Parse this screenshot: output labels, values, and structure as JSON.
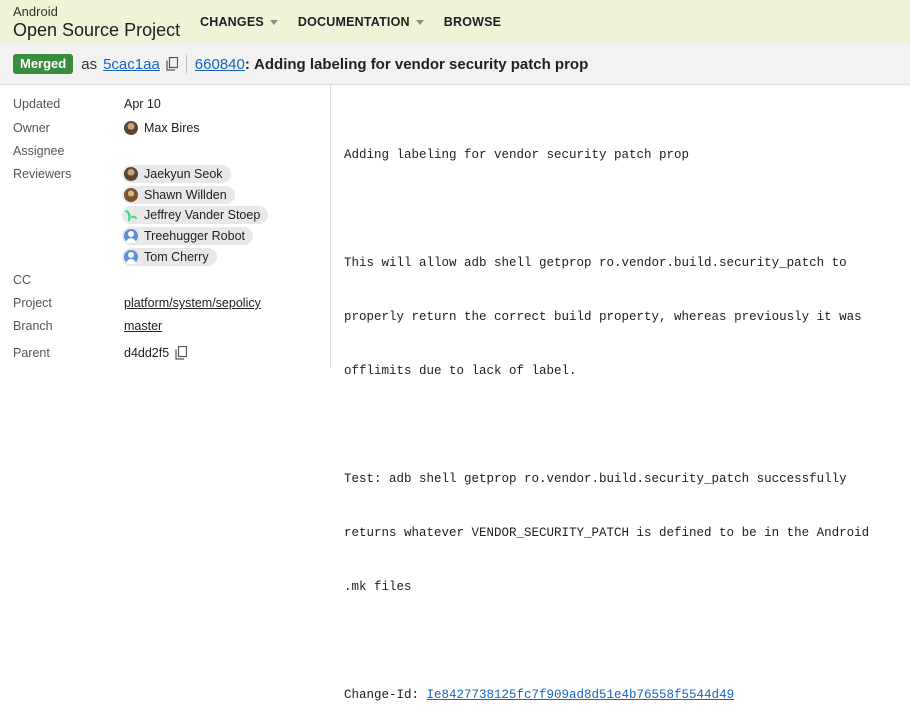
{
  "header": {
    "brand_small": "Android",
    "brand_big": "Open Source Project",
    "nav": [
      {
        "label": "CHANGES",
        "has_dropdown": true
      },
      {
        "label": "DOCUMENTATION",
        "has_dropdown": true
      },
      {
        "label": "BROWSE",
        "has_dropdown": false
      }
    ]
  },
  "change": {
    "status": "Merged",
    "as_text": "as",
    "commit": "5cac1aa",
    "number": "660840",
    "title": "Adding labeling for vendor security patch prop"
  },
  "meta": {
    "updated_label": "Updated",
    "updated_value": "Apr 10",
    "owner_label": "Owner",
    "owner_value": "Max Bires",
    "assignee_label": "Assignee",
    "reviewers_label": "Reviewers",
    "reviewers": [
      {
        "name": "Jaekyun Seok",
        "avatar": "photo"
      },
      {
        "name": "Shawn Willden",
        "avatar": "photo"
      },
      {
        "name": "Jeffrey Vander Stoep",
        "avatar": "android"
      },
      {
        "name": "Treehugger Robot",
        "avatar": "generic"
      },
      {
        "name": "Tom Cherry",
        "avatar": "generic"
      }
    ],
    "cc_label": "CC",
    "project_label": "Project",
    "project_value": "platform/system/sepolicy",
    "branch_label": "Branch",
    "branch_value": "master",
    "parent_label": "Parent",
    "parent_value": "d4dd2f5"
  },
  "message": {
    "subject": "Adding labeling for vendor security patch prop",
    "body1_line1": "This will allow adb shell getprop ro.vendor.build.security_patch to",
    "body1_line2": "properly return the correct build property, whereas previously it was",
    "body1_line3": "offlimits due to lack of label.",
    "test_line1": "Test: adb shell getprop ro.vendor.build.security_patch successfully",
    "test_line2": "returns whatever VENDOR_SECURITY_PATCH is defined to be in the Android",
    "test_line3": ".mk files",
    "change_id_label": "Change-Id: ",
    "change_id": "Ie8427738125fc7f909ad8d51e4b76558f5544d49"
  },
  "colors": {
    "header_bg": "#eef4d8",
    "merged_badge": "#388e3c",
    "link": "#1565c0"
  }
}
